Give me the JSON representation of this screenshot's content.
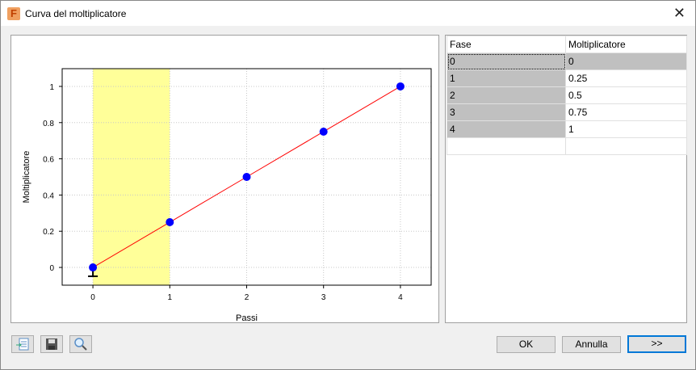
{
  "window": {
    "title": "Curva del moltiplicatore",
    "icon_letter": "F",
    "close": "✕"
  },
  "chart_data": {
    "type": "line",
    "title": "",
    "xlabel": "Passi",
    "ylabel": "Moltiplicatore",
    "x": [
      0,
      1,
      2,
      3,
      4
    ],
    "y": [
      0,
      0.25,
      0.5,
      0.75,
      1
    ],
    "xlim": [
      -0.4,
      4.4
    ],
    "ylim": [
      -0.098,
      1.098
    ],
    "xticks": [
      "0",
      "1",
      "2",
      "3",
      "4"
    ],
    "yticks": [
      "0",
      "0.2",
      "0.4",
      "0.6",
      "0.8",
      "1"
    ],
    "highlight_range": [
      0,
      1
    ],
    "highlight_color": "#ffff99",
    "line_color": "#ff0000",
    "marker_color": "#0000ff",
    "grid": true
  },
  "table": {
    "headers": [
      "Fase",
      "Moltiplicatore"
    ],
    "rows": [
      [
        "0",
        "0"
      ],
      [
        "1",
        "0.25"
      ],
      [
        "2",
        "0.5"
      ],
      [
        "3",
        "0.75"
      ],
      [
        "4",
        "1"
      ]
    ]
  },
  "buttons": {
    "ok": "OK",
    "cancel": "Annulla",
    "more": ">>"
  }
}
